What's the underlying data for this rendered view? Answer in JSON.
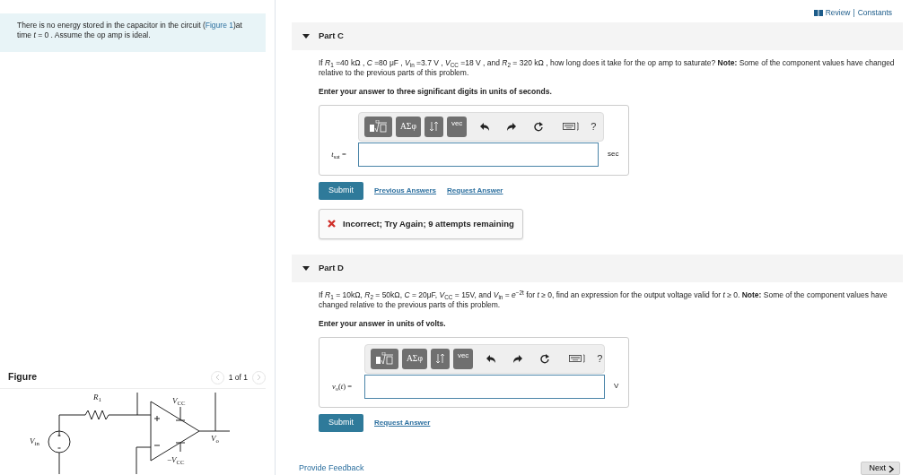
{
  "intro": {
    "before": "There is no energy stored in the capacitor in the circuit (",
    "link": "Figure 1",
    "after": ")at time *t* = 0 . Assume the op amp is ideal."
  },
  "figure": {
    "title": "Figure",
    "pager": "1 of 1",
    "prev_disabled": true,
    "next_disabled": true,
    "labels": [
      "*R*$_{1}$",
      "*V*$_{CC}$",
      "*V*$_{o}$",
      "*V*$_{in}$",
      "−*V*$_{CC}$"
    ]
  },
  "header_links": [
    "Review",
    "Constants"
  ],
  "header_separator": "|",
  "parts": [
    {
      "title": "Part C",
      "expanded": true,
      "question": "If *R*$_{1}$ =40 kΩ , *C* =80 μF , *V*$_{in}$ =3.7 V , *V*$_{CC}$ =18 V , and *R*$_{2}$ = 320 kΩ , how long does it take for the op amp to saturate? **Note:** Some of the component values have changed relative to the previous parts of this problem.",
      "instruction": "Enter your answer to three significant digits in units of seconds.",
      "toolbar": [
        "ΑΣφ",
        "vec",
        "?"
      ],
      "answer_label": "*t*$_{sat}$ =",
      "unit": "sec",
      "submit": "Submit",
      "links": [
        "Previous Answers",
        "Request Answer"
      ],
      "feedback": {
        "kind": "incorrect",
        "text": "Incorrect; Try Again; 9 attempts remaining"
      }
    },
    {
      "title": "Part D",
      "expanded": true,
      "question": "If *R*$_{1}$ = 10kΩ, *R*$_{2}$ = 50kΩ, *C* = 20μF, *V*$_{CC}$ = 15V, and *V*$_{in}$ = *e*$^{−2t}$ for *t* ≥ 0, find an expression for the output voltage valid for *t* ≥ 0. **Note:** Some of the component values have changed relative to the previous parts of this problem.",
      "instruction": "Enter your answer in units of volts.",
      "toolbar": [
        "ΑΣφ",
        "vec",
        "?"
      ],
      "answer_label": "*v*$_{o}$(*t*) =",
      "unit": "V",
      "submit": "Submit",
      "links": [
        "Request Answer"
      ]
    }
  ],
  "footer": {
    "feedback_link": "Provide Feedback",
    "next": "Next"
  }
}
